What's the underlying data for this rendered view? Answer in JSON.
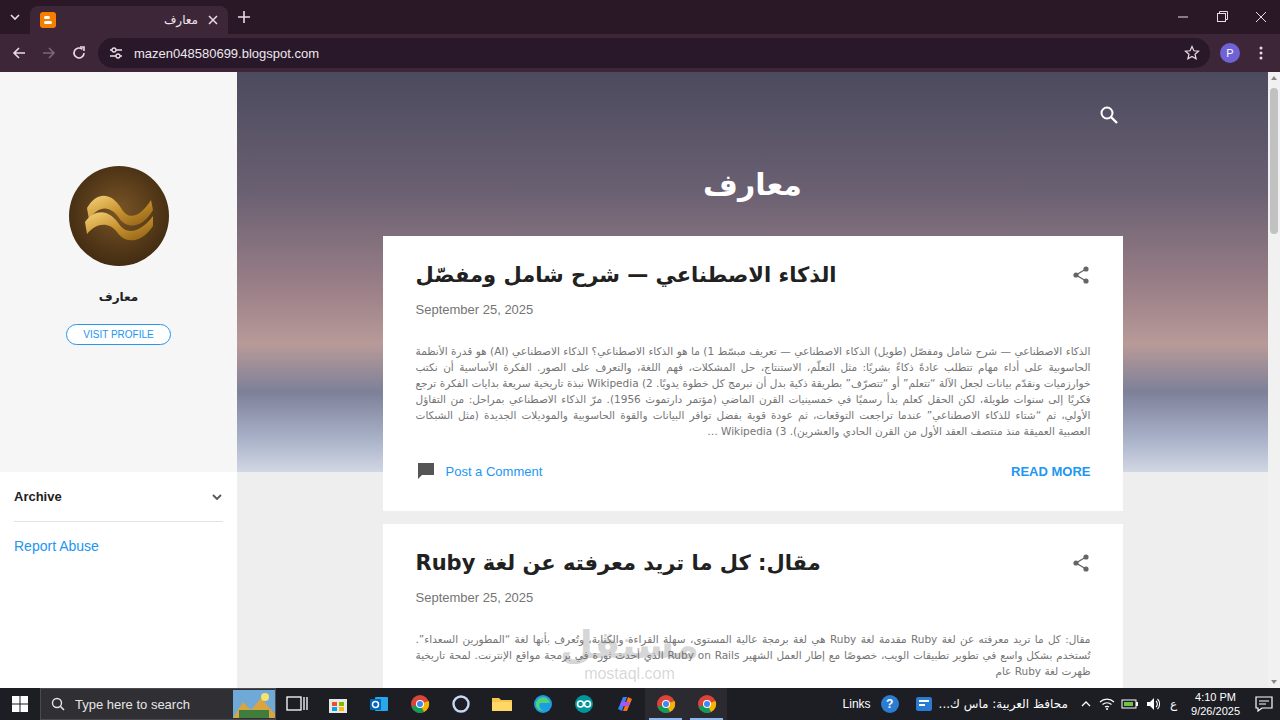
{
  "browser": {
    "tabs": [
      {
        "title": "معارف",
        "selected": true
      }
    ],
    "url": "mazen048580699.blogspot.com",
    "profile": "P",
    "can_go_forward": false
  },
  "blog": {
    "title": "معارف",
    "sidebar": {
      "name": "معارف",
      "visit_profile": "VISIT PROFILE",
      "archive": {
        "label": "Archive",
        "expanded": false
      },
      "report_abuse": "Report Abuse"
    },
    "posts": [
      {
        "title": "الذكاء الاصطناعي — شرح شامل ومفصّل",
        "date": "September 25, 2025",
        "excerpt": "الذكاء الاصطناعي — شرح شامل ومفصّل (طويل) الذكاء الاصطناعي — تعريف مبسّط 1) ما هو الذكاء الاصطناعي؟ الذكاء الاصطناعي (AI) هو قدرة الأنظمة الحاسوبية على أداء مهام تتطلب عادةً ذكاءً بشريًا: مثل التعلّم، الاستنتاج، حل المشكلات، فهم اللغة، والتعرف على الصور. الفكرة الأساسية أن نكتب خوارزميات ونقدّم بيانات لجعل الآلة “تتعلم” أو “تتصرّف” بطريقة ذكية بدل أن نبرمج كل خطوة يدويًا. Wikipedia (2 نبذة تاريخية سريعة بدايات الفكرة ترجع فكريًا إلى سنوات طويلة، لكن الحقل كعلم بدأ رسميًا في خمسينيات القرن الماضي (مؤتمر دارتموث 1956). مرّ الذكاء الاصطناعي بمراحل: من التفاؤل الأولي، ثم “شتاء للذكاء الاصطناعي” عندما تراجعت التوقعات، ثم عودة قوية بفضل توافر البيانات والقوة الحاسوبية والموديلات الجديدة (مثل الشبكات العصبية العميقة منذ منتصف العقد الأول من القرن الحادي والعشرين). Wikipedia (3 …",
        "comment_link": "Post a Comment",
        "read_more": "READ MORE"
      },
      {
        "title": "مقال: كل ما تريد معرفته عن لغة Ruby",
        "date": "September 25, 2025",
        "excerpt": "مقال: كل ما تريد معرفته عن لغة Ruby مقدمة لغة Ruby هي لغة برمجة عالية المستوى، سهلة القراءة والكتابة، وتُعرف بأنها لغة “المطورين السعداء”. تُستخدم بشكل واسع في تطوير تطبيقات الويب، خصوصًا مع إطار العمل الشهير Ruby on Rails الذي أحدث ثورة في برمجة مواقع الإنترنت. لمحة تاريخية ظهرت لغة Ruby عام"
      }
    ]
  },
  "watermark": {
    "arabic": "مستقل",
    "latin": "mostaql.com"
  },
  "taskbar": {
    "search_placeholder": "Type here to search",
    "apps": [
      {
        "kind": "task-view",
        "running": false
      },
      {
        "kind": "store",
        "running": false
      },
      {
        "kind": "outlook",
        "running": false
      },
      {
        "kind": "chrome",
        "running": false
      },
      {
        "kind": "cortana",
        "running": false
      },
      {
        "kind": "explorer",
        "running": false
      },
      {
        "kind": "edge",
        "running": false
      },
      {
        "kind": "arduino",
        "running": false
      },
      {
        "kind": "copilot",
        "running": false
      },
      {
        "kind": "chrome",
        "running": true
      },
      {
        "kind": "chrome",
        "running": true
      }
    ],
    "links": "Links",
    "help_icon": "?",
    "news": "محافظ العربية: ماس ك...",
    "language": "ع",
    "time": "4:10 PM",
    "date": "9/26/2025"
  }
}
